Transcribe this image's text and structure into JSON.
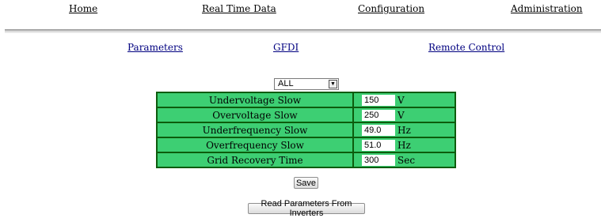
{
  "nav": {
    "home": "Home",
    "real_time_data": "Real Time Data",
    "configuration": "Configuration",
    "administration": "Administration"
  },
  "subnav": {
    "parameters": "Parameters",
    "gfdi": "GFDI",
    "remote_control": "Remote Control"
  },
  "selector": {
    "selected": "ALL"
  },
  "params": [
    {
      "label": "Undervoltage Slow",
      "value": "150",
      "unit": "V"
    },
    {
      "label": "Overvoltage Slow",
      "value": "250",
      "unit": "V"
    },
    {
      "label": "Underfrequency Slow",
      "value": "49.0",
      "unit": "Hz"
    },
    {
      "label": "Overfrequency Slow",
      "value": "51.0",
      "unit": "Hz"
    },
    {
      "label": "Grid Recovery Time",
      "value": "300",
      "unit": "Sec"
    }
  ],
  "buttons": {
    "save": "Save",
    "read_params": "Read Parameters From Inverters"
  },
  "colors": {
    "row_green": "#3dcf73",
    "border_dark_green": "#0d5c0d",
    "link_blue": "#000080"
  }
}
